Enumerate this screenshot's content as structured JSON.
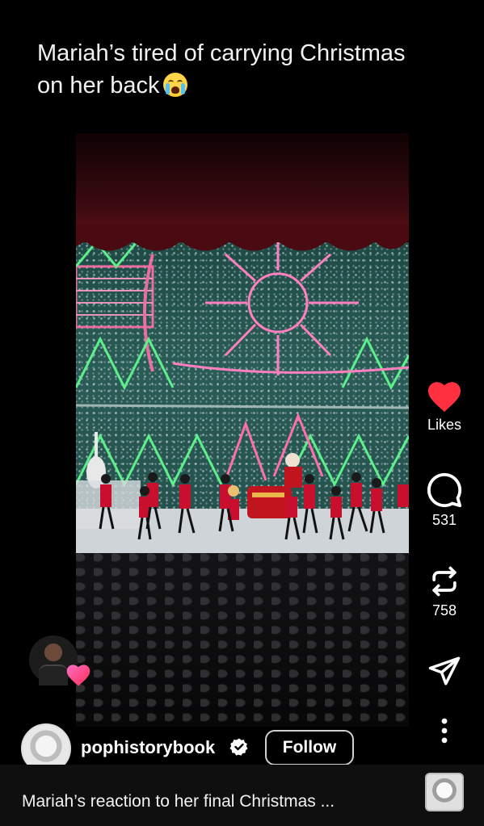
{
  "post": {
    "caption_line1": "Mariah’s tired of carrying Christmas",
    "caption_line2": "on her back",
    "emoji_icon": "loudly-crying-face"
  },
  "actions": {
    "likes_label": "Likes",
    "comments_count": "531",
    "reposts_count": "758",
    "like_color": "#ff3040"
  },
  "author": {
    "username": "pophistorybook",
    "verified": true,
    "follow_label": "Follow"
  },
  "footer": {
    "caption": "Mariah’s reaction to her final Christmas ..."
  }
}
